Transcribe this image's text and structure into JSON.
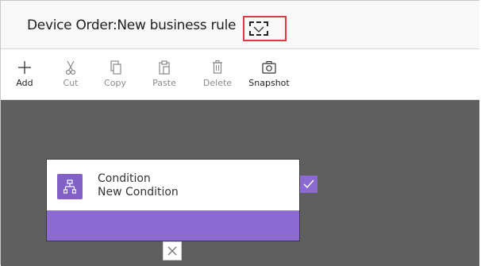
{
  "header": {
    "title": "Device Order:New business rule"
  },
  "toolbar": {
    "items": [
      {
        "label": "Add",
        "icon": "plus-icon"
      },
      {
        "label": "Cut",
        "icon": "scissors-icon"
      },
      {
        "label": "Copy",
        "icon": "copy-icon"
      },
      {
        "label": "Paste",
        "icon": "paste-icon"
      },
      {
        "label": "Delete",
        "icon": "trash-icon"
      },
      {
        "label": "Snapshot",
        "icon": "camera-icon"
      }
    ]
  },
  "canvas": {
    "condition_card": {
      "title": "Condition",
      "subtitle": "New Condition"
    }
  },
  "colors": {
    "accent_purple": "#8b6bd1",
    "highlight_red": "#e0393e",
    "canvas_bg": "#5f5f5f"
  }
}
